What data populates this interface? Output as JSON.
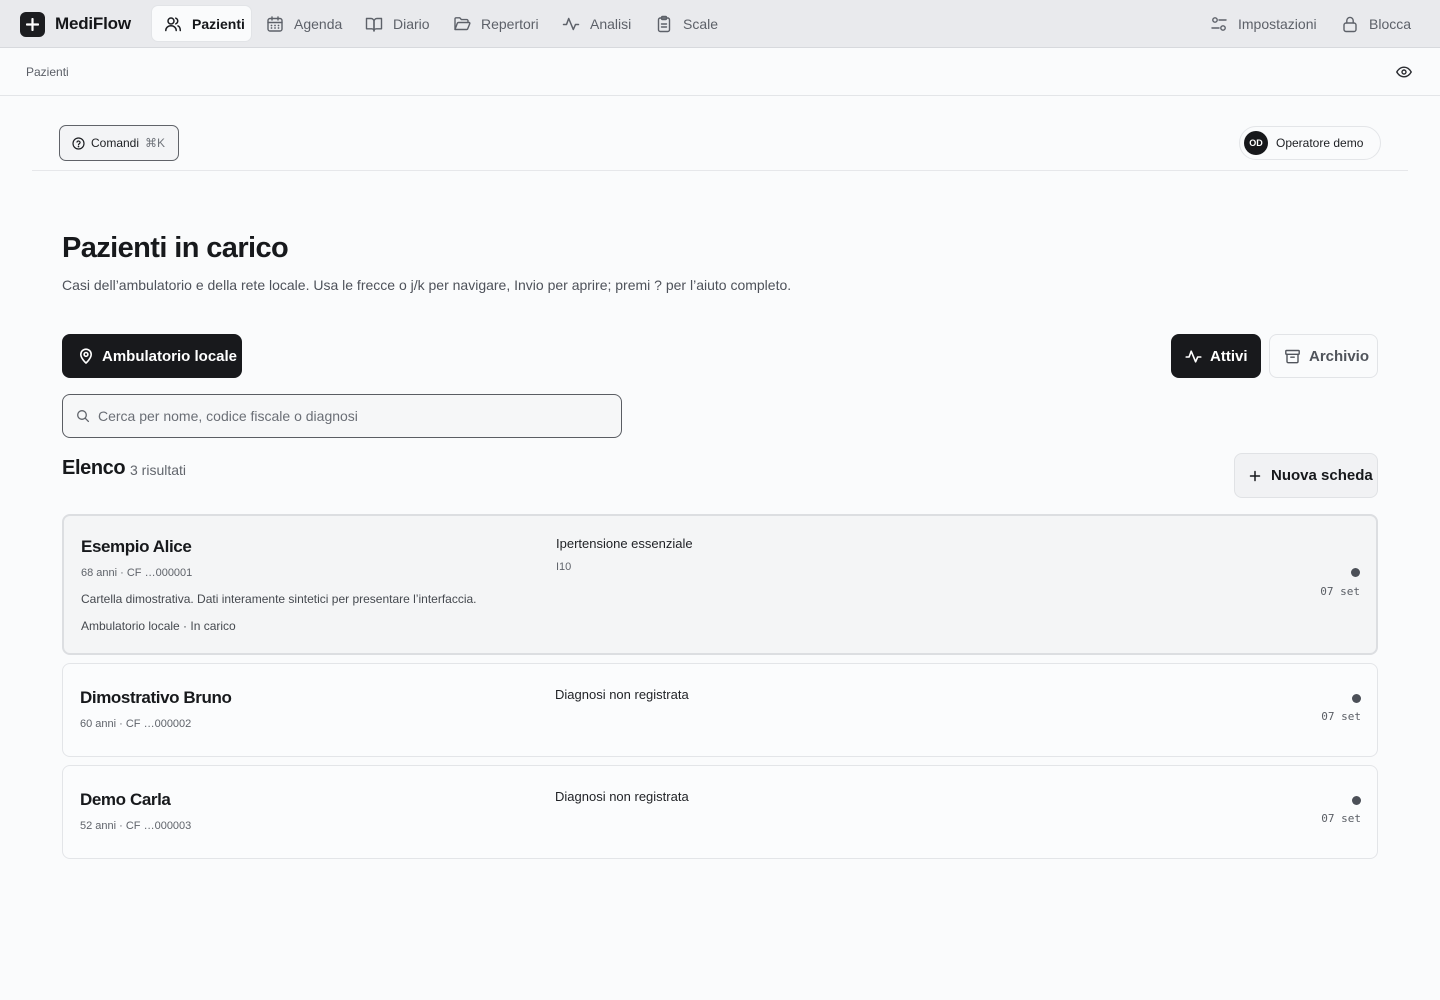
{
  "app": {
    "name": "MediFlow"
  },
  "nav": {
    "items": [
      {
        "label": "Pazienti",
        "icon": "users-icon",
        "active": true
      },
      {
        "label": "Agenda",
        "icon": "calendar-icon"
      },
      {
        "label": "Diario",
        "icon": "book-icon"
      },
      {
        "label": "Repertori",
        "icon": "folder-icon"
      },
      {
        "label": "Analisi",
        "icon": "activity-icon"
      },
      {
        "label": "Scale",
        "icon": "clipboard-icon"
      }
    ],
    "settings_label": "Impostazioni",
    "lock_label": "Blocca"
  },
  "breadcrumb": {
    "current": "Pazienti"
  },
  "header": {
    "command_label": "Comandi",
    "command_shortcut": "⌘K",
    "user_initials": "OD",
    "user_name": "Operatore demo"
  },
  "page": {
    "title": "Pazienti in carico",
    "subtitle": "Casi dell’ambulatorio e della rete locale. Usa le frecce o j/k per navigare, Invio per aprire; premi ? per l’aiuto completo."
  },
  "filters": {
    "location_label": "Ambulatorio locale",
    "active_label": "Attivi",
    "archive_label": "Archivio",
    "search_placeholder": "Cerca per nome, codice fiscale o diagnosi",
    "search_value": ""
  },
  "list": {
    "title": "Elenco",
    "count_label": "3 risultati",
    "new_label": "Nuova scheda",
    "patients": [
      {
        "name": "Esempio Alice",
        "meta": "68 anni · CF …000001",
        "note": "Cartella dimostrativa. Dati interamente sintetici per presentare l’interfaccia.",
        "location": "Ambulatorio locale · In carico",
        "diagnosis": "Ipertensione essenziale",
        "code": "I10",
        "date": "07 set",
        "selected": true
      },
      {
        "name": "Dimostrativo Bruno",
        "meta": "60 anni · CF …000002",
        "diagnosis": "Diagnosi non registrata",
        "date": "07 set"
      },
      {
        "name": "Demo Carla",
        "meta": "52 anni · CF …000003",
        "diagnosis": "Diagnosi non registrata",
        "date": "07 set"
      }
    ]
  },
  "colors": {
    "topbar": "#e9eaed",
    "background": "#fafbfc",
    "primary": "#18191c",
    "status_dot": "#4c5058"
  }
}
